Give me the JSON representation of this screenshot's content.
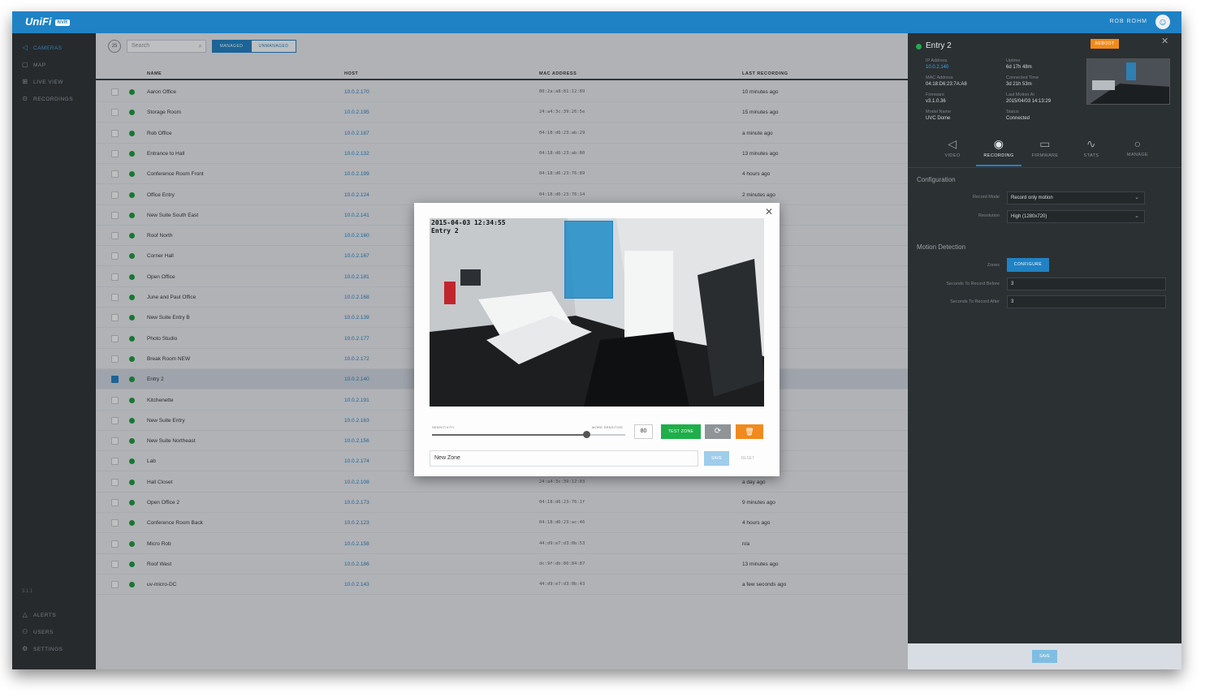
{
  "topbar": {
    "logo": "UniFi",
    "badge": "NVR",
    "user_name": "ROB ROHM",
    "accent": "#1f82c5"
  },
  "sidebar": {
    "items": [
      {
        "label": "CAMERAS",
        "icon": "camera-icon"
      },
      {
        "label": "MAP",
        "icon": "map-icon"
      },
      {
        "label": "LIVE VIEW",
        "icon": "live-view-icon"
      },
      {
        "label": "RECORDINGS",
        "icon": "recordings-icon"
      }
    ],
    "version": "3.1.1",
    "bottom_items": [
      {
        "label": "ALERTS",
        "icon": "bell-icon"
      },
      {
        "label": "USERS",
        "icon": "users-icon"
      },
      {
        "label": "SETTINGS",
        "icon": "gear-icon"
      }
    ]
  },
  "toolbar": {
    "count": "25",
    "search_placeholder": "Search",
    "tab_managed": "MANAGED",
    "tab_unmanaged": "UNMANAGED"
  },
  "table": {
    "columns": {
      "name": "NAME",
      "host": "HOST",
      "mac": "MAC ADDRESS",
      "last": "LAST RECORDING"
    },
    "rows": [
      {
        "name": "Aaron Office",
        "host": "10.0.2.170",
        "mac": "80:2a:a8:81:12:89",
        "last": "10 minutes ago"
      },
      {
        "name": "Storage Room",
        "host": "10.0.2.195",
        "mac": "24:a4:3c:39:26:5e",
        "last": "15 minutes ago"
      },
      {
        "name": "Rob Office",
        "host": "10.0.2.187",
        "mac": "04:18:d6:23:ab:29",
        "last": "a minute ago"
      },
      {
        "name": "Entrance to Hall",
        "host": "10.0.2.132",
        "mac": "04:18:d6:23:ab:80",
        "last": "13 minutes ago"
      },
      {
        "name": "Conference Room Front",
        "host": "10.0.2.199",
        "mac": "04:18:d6:23:76:89",
        "last": "4 hours ago"
      },
      {
        "name": "Office Entry",
        "host": "10.0.2.124",
        "mac": "04:18:d6:23:76:14",
        "last": "2 minutes ago"
      },
      {
        "name": "New Suite South East",
        "host": "10.0.2.141",
        "mac": "",
        "last": ""
      },
      {
        "name": "Roof North",
        "host": "10.0.2.160",
        "mac": "",
        "last": ""
      },
      {
        "name": "Corner Hall",
        "host": "10.0.2.167",
        "mac": "",
        "last": "ago"
      },
      {
        "name": "Open Office",
        "host": "10.0.2.181",
        "mac": "",
        "last": ""
      },
      {
        "name": "June and Paul Office",
        "host": "10.0.2.168",
        "mac": "",
        "last": ""
      },
      {
        "name": "New Suite Entry B",
        "host": "10.0.2.139",
        "mac": "",
        "last": ""
      },
      {
        "name": "Photo Studio",
        "host": "10.0.2.177",
        "mac": "",
        "last": ""
      },
      {
        "name": "Break Room NEW",
        "host": "10.0.2.172",
        "mac": "",
        "last": ""
      },
      {
        "name": "Entry 2",
        "host": "10.0.2.140",
        "mac": "",
        "last": "",
        "selected": true
      },
      {
        "name": "Kitchenette",
        "host": "10.0.2.191",
        "mac": "",
        "last": ""
      },
      {
        "name": "New Suite Entry",
        "host": "10.0.2.163",
        "mac": "",
        "last": ""
      },
      {
        "name": "New Suite Northeast",
        "host": "10.0.2.156",
        "mac": "",
        "last": ""
      },
      {
        "name": "Lab",
        "host": "10.0.2.174",
        "mac": "",
        "last": ""
      },
      {
        "name": "Hall Closet",
        "host": "10.0.2.108",
        "mac": "24:a4:3c:39:12:03",
        "last": "a day ago"
      },
      {
        "name": "Open Office 2",
        "host": "10.0.2.173",
        "mac": "04:18:d6:23:76:1f",
        "last": "9 minutes ago"
      },
      {
        "name": "Conference Room Back",
        "host": "10.0.2.123",
        "mac": "04:18:d6:23:ac:46",
        "last": "4 hours ago"
      },
      {
        "name": "Micro Rob",
        "host": "10.0.2.158",
        "mac": "44:d9:e7:d3:0b:53",
        "last": "n/a"
      },
      {
        "name": "Roof West",
        "host": "10.0.2.186",
        "mac": "dc:9f:db:80:84:87",
        "last": "13 minutes ago"
      },
      {
        "name": "uv-micro-DC",
        "host": "10.0.2.143",
        "mac": "44:d9:e7:d3:0b:43",
        "last": "a few seconds ago"
      }
    ]
  },
  "panel": {
    "title": "Entry 2",
    "reboot_label": "REBOOT",
    "meta": [
      {
        "label": "IP Address",
        "value": "10.0.2.140",
        "link": true
      },
      {
        "label": "Uptime",
        "value": "6d 17h 48m"
      },
      {
        "label": "MAC Address",
        "value": "04:18:D6:23:7A:A8"
      },
      {
        "label": "Connected Time",
        "value": "3d 21h 53m"
      },
      {
        "label": "Firmware",
        "value": "v3.1.0.36"
      },
      {
        "label": "Last Motion At",
        "value": "2015/04/03 14:13:29"
      },
      {
        "label": "Model Name",
        "value": "UVC Dome"
      },
      {
        "label": "Status",
        "value": "Connected"
      }
    ],
    "tabs": [
      {
        "label": "VIDEO",
        "icon": "video-icon"
      },
      {
        "label": "RECORDING",
        "icon": "recording-icon"
      },
      {
        "label": "FIRMWARE",
        "icon": "firmware-icon"
      },
      {
        "label": "STATS",
        "icon": "stats-icon"
      },
      {
        "label": "MANAGE",
        "icon": "manage-icon"
      }
    ],
    "configuration_title": "Configuration",
    "record_mode_label": "Record Mode",
    "record_mode_value": "Record only motion",
    "resolution_label": "Resolution",
    "resolution_value": "High (1280x720)",
    "motion_title": "Motion Detection",
    "zones_label": "Zones",
    "configure_label": "CONFIGURE",
    "before_label": "Seconds To Record Before",
    "before_value": "3",
    "after_label": "Seconds To Record After",
    "after_value": "3",
    "save_label": "SAVE"
  },
  "modal": {
    "timestamp": "2015-04-03 12:34:55",
    "camera_name": "Entry 2",
    "sensitivity_low": "SENSITIVITY",
    "sensitivity_high": "MORE SENSITIVE",
    "sensitivity_value": "80",
    "sensitivity_fraction": 0.8,
    "test_zone_label": "TEST ZONE",
    "zone_name": "New Zone",
    "save_label": "SAVE",
    "reset_label": "RESET",
    "colors": {
      "test": "#1fae48",
      "delete": "#f08a1c",
      "zone": "#1f82c5"
    }
  }
}
